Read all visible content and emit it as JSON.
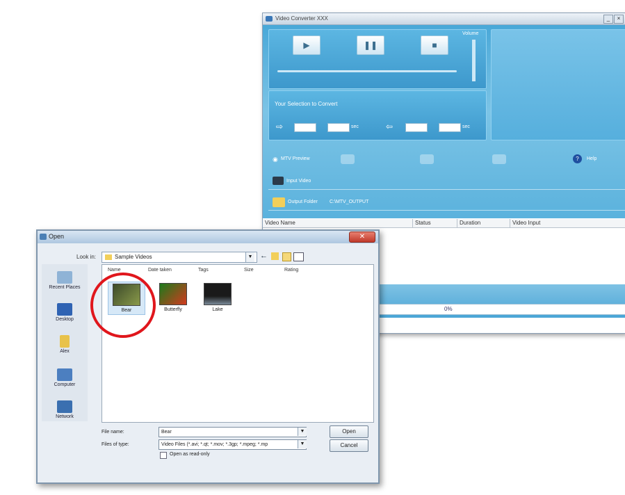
{
  "converter": {
    "title": "Video Converter XXX",
    "selection_label": "Your Selection to Convert",
    "volume_label": "Volume",
    "start_unit": "sec",
    "end_unit": "sec",
    "mtv_label": "MTV Preview",
    "help_label": "Help",
    "input_label": "Input Video",
    "output_label": "Output Folder",
    "output_path": "C:\\MTV_OUTPUT",
    "columns": [
      "Video Name",
      "Status",
      "Duration",
      "Video Input"
    ],
    "status_value": "0%"
  },
  "dialog": {
    "title": "Open",
    "look_in_label": "Look in:",
    "look_in_value": "Sample Videos",
    "places": [
      "Recent Places",
      "Desktop",
      "Alex",
      "Computer",
      "Network"
    ],
    "columns": [
      "Name",
      "Date taken",
      "Tags",
      "Size",
      "Rating"
    ],
    "files": [
      {
        "name": "Bear",
        "colors": [
          "#3c4a2a",
          "#8a9a4a"
        ]
      },
      {
        "name": "Butterfly",
        "colors": [
          "#1b7a1b",
          "#d23a1e"
        ]
      },
      {
        "name": "Lake",
        "colors": [
          "#1a1a1a",
          "#7a8a99"
        ]
      }
    ],
    "filename_label": "File name:",
    "filename_value": "Bear",
    "filetype_label": "Files of type:",
    "filetype_value": "Video Files (*.avi; *.qt; *.mov; *.3gp; *.mpeg; *.mp",
    "readonly_label": "Open as read-only",
    "open_label": "Open",
    "cancel_label": "Cancel"
  },
  "highlight_color": "#e0161c"
}
